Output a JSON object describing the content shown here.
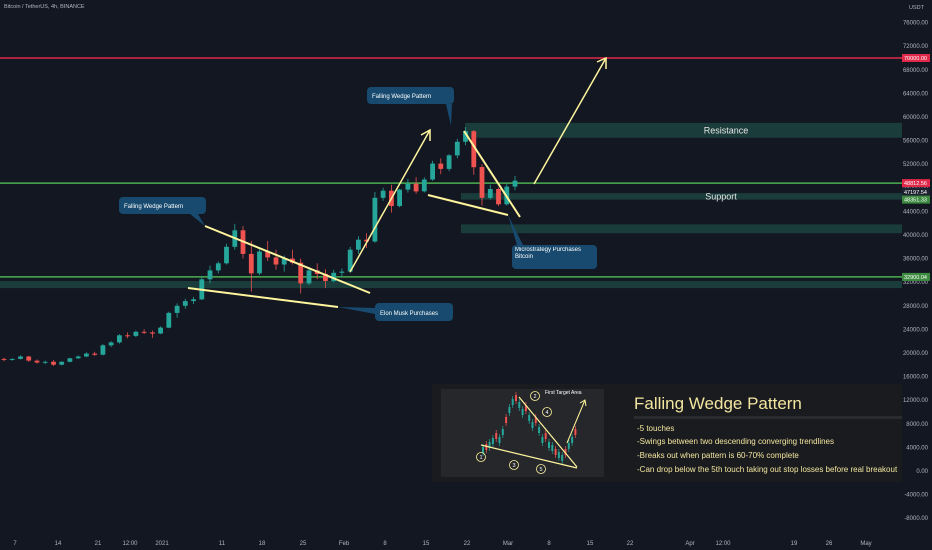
{
  "header": {
    "symbol_line": "Bitcoin / TetherUS, 4h, BINANCE",
    "currency": "USDT"
  },
  "chart_data": {
    "type": "candlestick",
    "title": "Bitcoin / TetherUS, 4h, BINANCE",
    "y_unit": "USDT",
    "ylim": [
      -10000,
      80000
    ],
    "y_ticks": [
      "76000.00",
      "72000.00",
      "68000.00",
      "64000.00",
      "60000.00",
      "56000.00",
      "52000.00",
      "48000.00",
      "44000.00",
      "40000.00",
      "36000.00",
      "32000.00",
      "28000.00",
      "24000.00",
      "20000.00",
      "16000.00",
      "12000.00",
      "8000.00",
      "4000.00",
      "0.00",
      "-4000.00",
      "-8000.00"
    ],
    "x_ticks": [
      "7",
      "14",
      "21",
      "12:00",
      "2021",
      "11",
      "18",
      "25",
      "Feb",
      "8",
      "15",
      "22",
      "Mar",
      "8",
      "15",
      "22",
      "Apr",
      "12:00",
      "19",
      "26",
      "May"
    ],
    "horizontal_lines": [
      {
        "name": "target",
        "value": 70000,
        "color": "#e0294a",
        "label": "70000.00"
      },
      {
        "name": "resistance-line",
        "value": 48800,
        "color": "#4caf50",
        "label": "48812.56"
      },
      {
        "name": "support-line",
        "value": 32900,
        "color": "#4caf50",
        "label": "32900.04"
      }
    ],
    "price_tags": {
      "current": "48812.56",
      "second": "47197.54",
      "support_tag": "48351.33"
    },
    "zones": [
      {
        "label": "Resistance",
        "from": 56500,
        "to": 59000
      },
      {
        "label": "Support",
        "from": 46000,
        "to": 47100
      },
      {
        "label": "",
        "from": 40300,
        "to": 41800
      },
      {
        "label": "",
        "from": 31000,
        "to": 32200
      }
    ],
    "callouts": [
      {
        "text": "Falling Wedge Pattern"
      },
      {
        "text": "Falling Wedge Pattern"
      },
      {
        "text": "Elon Musk Purchases"
      },
      {
        "text": "Microstrategy Purchases Bitcoin"
      }
    ],
    "series": [
      {
        "values": [
          [
            19000,
            19200,
            18600,
            18900
          ],
          [
            18900,
            19100,
            18700,
            19000
          ],
          [
            19000,
            19600,
            18900,
            19400
          ],
          [
            19400,
            19500,
            18500,
            18700
          ],
          [
            18700,
            18900,
            18200,
            18400
          ],
          [
            18400,
            18700,
            18100,
            18500
          ],
          [
            18500,
            18800,
            17800,
            18000
          ],
          [
            18000,
            18600,
            17900,
            18500
          ],
          [
            18500,
            19200,
            18400,
            19100
          ],
          [
            19100,
            19600,
            19000,
            19400
          ],
          [
            19400,
            20100,
            19300,
            19900
          ],
          [
            19900,
            20200,
            19500,
            19700
          ],
          [
            19700,
            21500,
            19600,
            21300
          ],
          [
            21300,
            22000,
            21000,
            21800
          ],
          [
            21800,
            23200,
            21600,
            23000
          ],
          [
            23000,
            23500,
            22500,
            22900
          ],
          [
            22900,
            23800,
            22700,
            23600
          ],
          [
            23600,
            24000,
            23200,
            23500
          ],
          [
            23500,
            23800,
            22600,
            23300
          ],
          [
            23300,
            24500,
            23200,
            24300
          ],
          [
            24300,
            27000,
            24200,
            26800
          ],
          [
            26800,
            28400,
            26000,
            28000
          ],
          [
            28000,
            29200,
            27500,
            28800
          ],
          [
            28800,
            29500,
            28300,
            29100
          ],
          [
            29100,
            33000,
            29000,
            32500
          ],
          [
            32500,
            34800,
            31800,
            34000
          ],
          [
            34000,
            35500,
            33500,
            35200
          ],
          [
            35200,
            38500,
            35000,
            38000
          ],
          [
            38000,
            41900,
            37500,
            40800
          ],
          [
            40800,
            41500,
            36000,
            36800
          ],
          [
            36800,
            39000,
            30400,
            33500
          ],
          [
            33500,
            37800,
            33200,
            37200
          ],
          [
            37200,
            39000,
            35600,
            36200
          ],
          [
            36200,
            37500,
            34100,
            35000
          ],
          [
            35000,
            36500,
            33800,
            36000
          ],
          [
            36000,
            37500,
            35000,
            35300
          ],
          [
            35300,
            36000,
            30100,
            31800
          ],
          [
            31800,
            34500,
            31500,
            34000
          ],
          [
            34000,
            35200,
            32500,
            33400
          ],
          [
            33400,
            34200,
            31000,
            32200
          ],
          [
            32200,
            34100,
            32000,
            33600
          ],
          [
            33600,
            34300,
            32800,
            33800
          ],
          [
            33800,
            38000,
            33600,
            37500
          ],
          [
            37500,
            39800,
            36800,
            39200
          ],
          [
            39200,
            40300,
            37800,
            38900
          ],
          [
            38900,
            47300,
            38700,
            46300
          ],
          [
            46300,
            48000,
            45800,
            47500
          ],
          [
            47500,
            48500,
            43800,
            44900
          ],
          [
            44900,
            47800,
            44700,
            47700
          ],
          [
            47700,
            49500,
            47200,
            48700
          ],
          [
            48700,
            49800,
            47000,
            47400
          ],
          [
            47400,
            49800,
            47200,
            49400
          ],
          [
            49400,
            52600,
            49200,
            52100
          ],
          [
            52100,
            53000,
            50300,
            51200
          ],
          [
            51200,
            53700,
            50800,
            53500
          ],
          [
            53500,
            56300,
            53000,
            55800
          ],
          [
            55800,
            58300,
            55200,
            57600
          ],
          [
            57600,
            57800,
            50200,
            51500
          ],
          [
            51500,
            52000,
            45000,
            46300
          ],
          [
            46300,
            48500,
            46000,
            47800
          ],
          [
            47800,
            48000,
            44900,
            45200
          ],
          [
            45200,
            48800,
            45000,
            48200
          ],
          [
            48200,
            50000,
            47600,
            49200
          ]
        ]
      }
    ]
  },
  "info_panel": {
    "title": "Falling Wedge Pattern",
    "bullets": [
      "-5 touches",
      "-Swings between two descending converging trendlines",
      "-Breaks out when pattern is 60-70% complete",
      "-Can drop below the 5th touch taking out stop losses before real breakout"
    ],
    "mini_chart": {
      "target_label": "First Target Area",
      "touch_labels": [
        "1",
        "2",
        "3",
        "4",
        "5"
      ]
    }
  }
}
